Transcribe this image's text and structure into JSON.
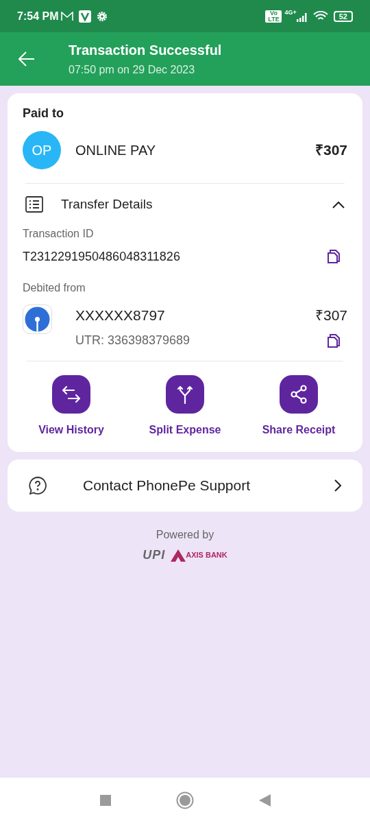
{
  "status_bar": {
    "time": "7:54 PM",
    "volte": "Vo LTE",
    "network": "4G+",
    "battery": "52"
  },
  "header": {
    "title": "Transaction Successful",
    "subtitle": "07:50 pm on 29 Dec 2023"
  },
  "paid_to": {
    "label": "Paid to",
    "initials": "OP",
    "name": "ONLINE PAY",
    "amount": "₹307"
  },
  "transfer_details": {
    "title": "Transfer Details",
    "expanded": true,
    "transaction_id_label": "Transaction ID",
    "transaction_id": "T2312291950486048311826",
    "debited_label": "Debited from",
    "account": "XXXXXX8797",
    "amount": "₹307",
    "utr": "UTR: 336398379689"
  },
  "actions": [
    {
      "kind": "history",
      "label": "View History"
    },
    {
      "kind": "split",
      "label": "Split Expense"
    },
    {
      "kind": "share",
      "label": "Share Receipt"
    }
  ],
  "support": {
    "label": "Contact PhonePe Support"
  },
  "footer": {
    "powered_by": "Powered by",
    "upi": "UPI",
    "bank": "AXIS BANK"
  }
}
